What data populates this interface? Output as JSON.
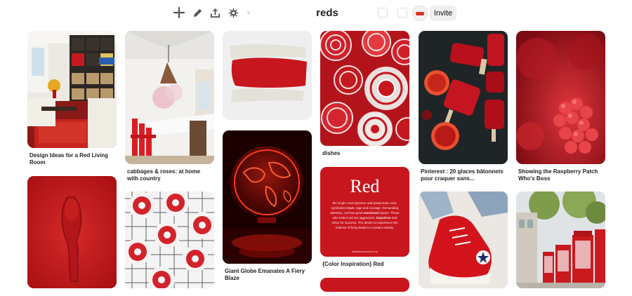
{
  "toolbar": {
    "board_title": "reds",
    "invite_label": "Invite",
    "icons": [
      "plus-icon",
      "edit-pencil-icon",
      "share-upload-icon",
      "organize-gear-icon",
      "more-dot-icon"
    ]
  },
  "colors": {
    "accent_red": "#c8161e",
    "dark_red": "#8e0b10",
    "panel_bg": "#efefef"
  },
  "pins": [
    {
      "caption": "Design Ideas for a Red Living Room"
    },
    {
      "caption": ""
    },
    {
      "caption": "cabbages & roses: at home with country"
    },
    {
      "caption": ""
    },
    {
      "caption": ""
    },
    {
      "caption": "Giant Globe Emanates A Fiery Blaze"
    },
    {
      "caption": "dishes"
    },
    {
      "caption": "{Color Inspiration} Red"
    },
    {
      "caption": ""
    },
    {
      "caption": "Pinterest : 20 glaces bâtonnets pour craquer sans..."
    },
    {
      "caption": ""
    },
    {
      "caption": "Showing the Raspberry Patch Who's Boss"
    },
    {
      "caption": ""
    }
  ],
  "color_card": {
    "title": "Red",
    "body_parts": [
      "the single most dynamic and passionate color, symbolizes ",
      "love",
      ", rage and courage. Demanding attention, red has great ",
      "emotional",
      " impact. Those who select red are aggressive, ",
      "impulsive",
      " and strive for success. The desire to experience the fullness of living leads to constant activity."
    ],
    "footer": "artdefinedscentral.ca"
  }
}
